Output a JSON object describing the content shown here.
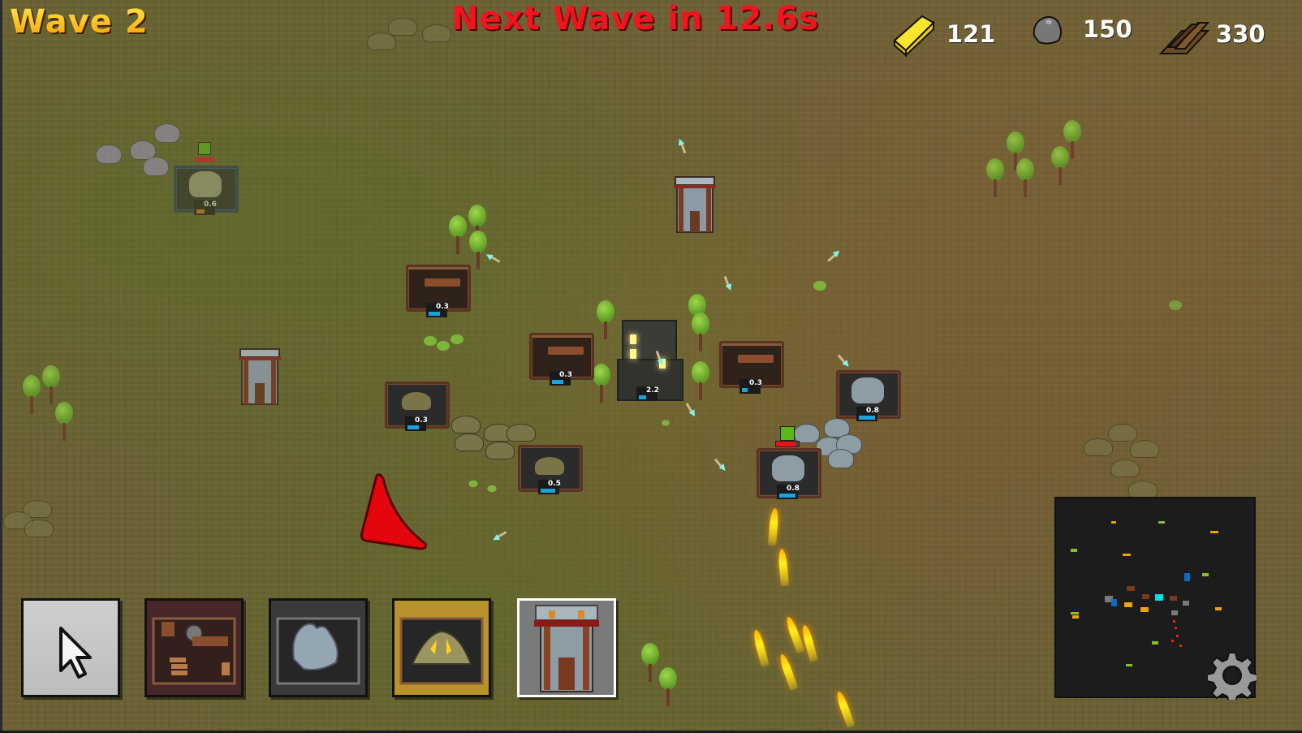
{
  "hud": {
    "wave_label": "Wave 2",
    "next_wave_label": "Next Wave in 12.6s",
    "resources": [
      {
        "name": "gold",
        "icon": "gold-bar-icon",
        "value": "121",
        "color": "#f7e226"
      },
      {
        "name": "stone",
        "icon": "stone-icon",
        "value": "150",
        "color": "#7a7a7a"
      },
      {
        "name": "wood",
        "icon": "wood-planks-icon",
        "value": "330",
        "color": "#7a4f24"
      }
    ]
  },
  "map": {
    "town_hall": {
      "production": "2.2",
      "resource": "wood",
      "progress": 0.45
    },
    "buildings": [
      {
        "type": "lumber-mill",
        "production": "0.3",
        "resource": "wood",
        "progress": 0.55
      },
      {
        "type": "lumber-mill",
        "production": "0.3",
        "resource": "wood",
        "progress": 0.55
      },
      {
        "type": "lumber-mill",
        "production": "0.3",
        "resource": "wood",
        "progress": 0.3
      },
      {
        "type": "gold-mine",
        "production": "0.3",
        "resource": "gold",
        "progress": 0.55
      },
      {
        "type": "gold-mine",
        "production": "0.5",
        "resource": "gold",
        "progress": 0.7
      },
      {
        "type": "stone-quarry",
        "production": "0.8",
        "resource": "stone",
        "progress": 0.85
      },
      {
        "type": "stone-quarry",
        "production": "0.8",
        "resource": "stone",
        "progress": 0.85
      },
      {
        "type": "stone-quarry-ghost",
        "production": "0.6",
        "resource": "stone",
        "progress": 0.4
      }
    ],
    "enemy_health_fraction": 0.85
  },
  "toolbar": {
    "slots": [
      {
        "name": "select",
        "icon": "cursor-icon",
        "bg": "#c4c4c4",
        "selected": false
      },
      {
        "name": "lumber-mill",
        "icon": "lumber-mill-icon",
        "bg": "#47262a",
        "selected": false
      },
      {
        "name": "stone-quarry",
        "icon": "stone-quarry-icon",
        "bg": "#3a3a3a",
        "selected": false
      },
      {
        "name": "gold-mine",
        "icon": "gold-mine-icon",
        "bg": "#b8922a",
        "selected": false
      },
      {
        "name": "tower",
        "icon": "tower-icon",
        "bg": "#7a7a7a",
        "selected": true
      }
    ]
  },
  "minimap": {
    "label": "minimap"
  },
  "settings": {
    "icon": "gear-icon"
  }
}
